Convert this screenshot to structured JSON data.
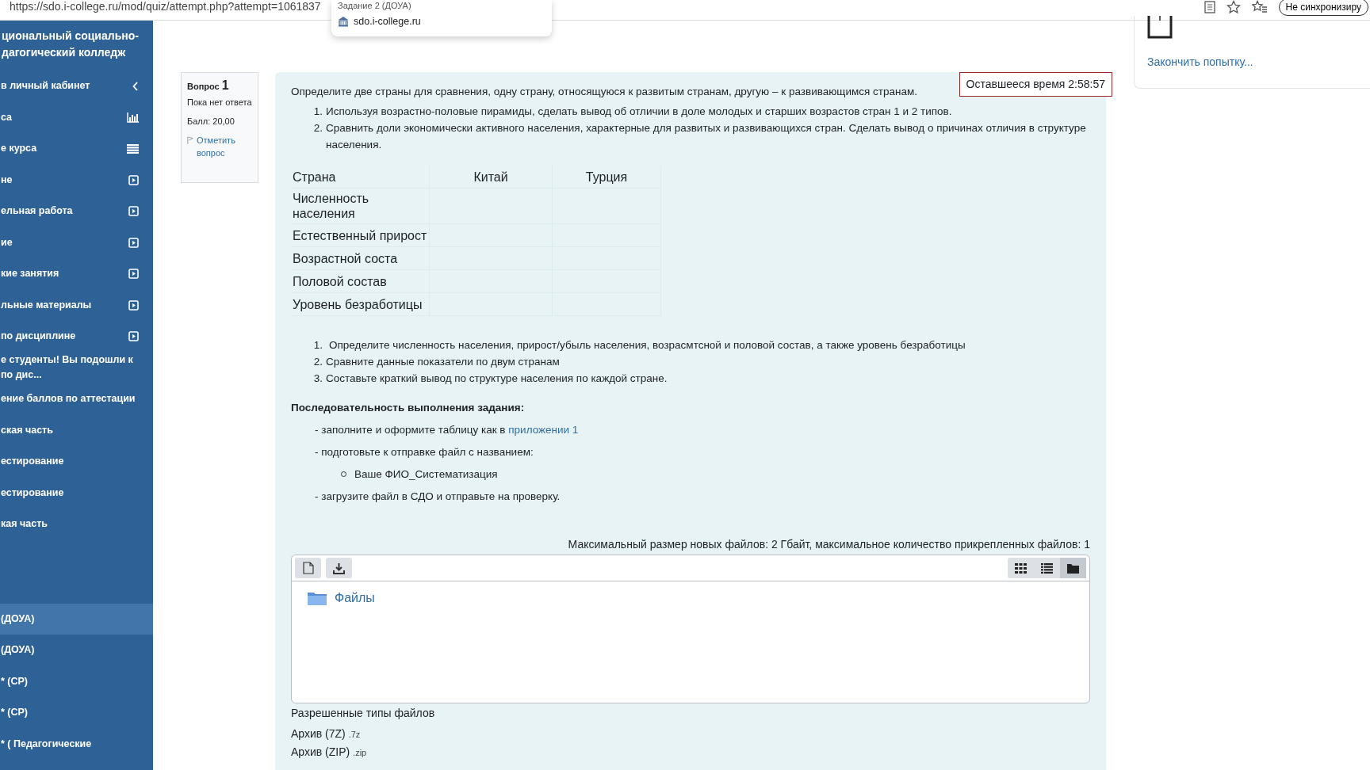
{
  "browser": {
    "url": "https://sdo.i-college.ru/mod/quiz/attempt.php?attempt=1061837",
    "tab_popup": {
      "title": "Задание 2  (ДОУА)",
      "site": "sdo.i-college.ru"
    },
    "sync_button": "Не синхронизиру"
  },
  "sidebar": {
    "title_lines": [
      "циональный социально-",
      "дагогический колледж"
    ],
    "items": [
      {
        "label": "в личный кабинет",
        "kind": "collapse",
        "selected": false
      },
      {
        "label": "са",
        "kind": "reports",
        "selected": false
      },
      {
        "label": "е курса",
        "kind": "contents",
        "selected": false
      },
      {
        "label": "не",
        "kind": "section",
        "selected": false
      },
      {
        "label": "ельная работа",
        "kind": "section",
        "selected": false
      },
      {
        "label": "ие",
        "kind": "section",
        "selected": false
      },
      {
        "label": "кие занятия",
        "kind": "section",
        "selected": false
      },
      {
        "label": "льные материалы",
        "kind": "section",
        "selected": false
      },
      {
        "label": "по дисциплине",
        "kind": "section",
        "selected": false
      },
      {
        "label": "е студенты! Вы подошли к\nпо дис...",
        "kind": "plain",
        "selected": false
      },
      {
        "label": "ение баллов по аттестации",
        "kind": "plain",
        "selected": false
      },
      {
        "label": "ская часть",
        "kind": "plain",
        "selected": false
      },
      {
        "label": "естирование",
        "kind": "plain",
        "selected": false
      },
      {
        "label": "естирование",
        "kind": "plain",
        "selected": false
      },
      {
        "label": "кая часть",
        "kind": "plain",
        "selected": false
      }
    ],
    "activities": [
      {
        "label": "(ДОУА)",
        "selected": true
      },
      {
        "label": "(ДОУА)",
        "selected": false
      },
      {
        "label": "* (СР)",
        "selected": false
      },
      {
        "label": "* (СР)",
        "selected": false
      },
      {
        "label": "* ( Педагогические",
        "selected": false
      }
    ]
  },
  "question_info": {
    "label": "Вопрос",
    "number": "1",
    "status": "Пока нет ответа",
    "grade": "Балл: 20,00",
    "flag": "Отметить вопрос"
  },
  "timer": "Оставшееся время 2:58:57",
  "question": {
    "intro": "Определите две страны для сравнения, одну страну, относящуюся к развитым странам, другую – к развивающимся странам.",
    "tasks": [
      {
        "marker": "1.",
        "text": "Используя возрастно-половые пирамиды, сделать вывод об отличии в доле молодых и старших возрастов стран 1 и 2 типов."
      },
      {
        "marker": "2.",
        "text": "Сравнить доли экономически активного населения, характерные для развитых и развивающихся стран. Сделать вывод о причинах отличия в структуре населения."
      }
    ],
    "table": {
      "header": [
        "Страна",
        "Китай",
        "Турция"
      ],
      "rows": [
        "Численность населения",
        "Естественный прирост",
        "Возрастной соста",
        "Половой состав",
        "Уровень безработицы"
      ]
    },
    "steps": [
      {
        "marker": "1.",
        "text": "Определите численность населения, прирост/убыль населения, возрасмтсной и половой состав, а также уровень безработицы"
      },
      {
        "marker": "2.",
        "text": "Сравните данные показатели по двум странам"
      },
      {
        "marker": "3.",
        "text": "Составьте краткий вывод по структуре населения по каждой стране."
      }
    ],
    "sequence_title": "Последовательность выполнения задания:",
    "sequence": [
      {
        "kind": "dash",
        "text": "- заполните и оформите таблицу как в ",
        "link": "приложении 1"
      },
      {
        "kind": "dash",
        "text": "- подготовьте к отправке файл с названием:"
      },
      {
        "kind": "bullet",
        "text": "Ваше ФИО_Систематизация"
      },
      {
        "kind": "dash",
        "text": "- загрузите файл в СДО и отправьте на проверку."
      }
    ]
  },
  "filemanager": {
    "limits": "Максимальный размер новых файлов: 2 Гбайт, максимальное количество прикрепленных файлов: 1",
    "views": [
      {
        "kind": "grid",
        "selected": false
      },
      {
        "kind": "list",
        "selected": false
      },
      {
        "kind": "tree",
        "selected": true
      }
    ],
    "folder": "Файлы",
    "allowed_title": "Разрешенные типы файлов",
    "types": [
      {
        "name": "Архив (7Z)",
        "ext": ".7z"
      },
      {
        "name": "Архив (ZIP)",
        "ext": ".zip"
      }
    ]
  },
  "nav": {
    "finish": "Закончить попытку..."
  }
}
